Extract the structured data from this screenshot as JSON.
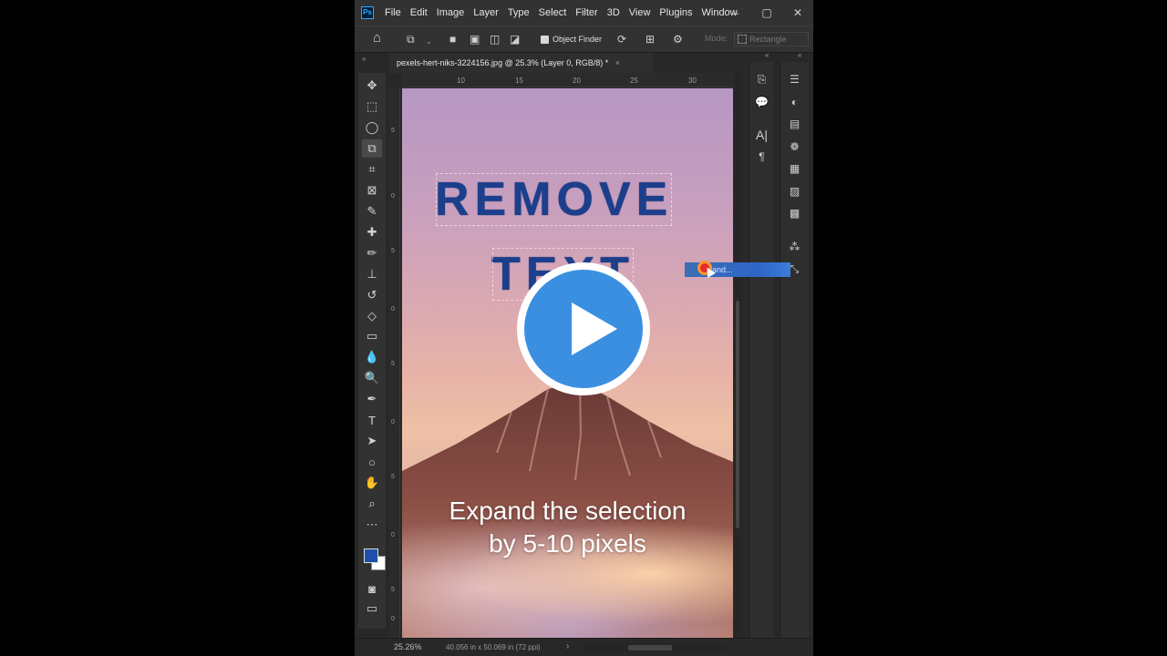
{
  "app": {
    "logo_text": "Ps"
  },
  "menu": {
    "items": [
      "File",
      "Edit",
      "Image",
      "Layer",
      "Type",
      "Select",
      "Filter",
      "3D",
      "View",
      "Plugins",
      "Window"
    ]
  },
  "window_controls": {
    "minimize": "–",
    "maximize": "▢",
    "close": "✕"
  },
  "options_bar": {
    "object_finder_label": "Object Finder",
    "object_finder_checked": true,
    "mode_label": "Mode:",
    "mode_value": "Rectangle"
  },
  "document_tab": {
    "title": "pexels-hert-niks-3224156.jpg @ 25.3% (Layer 0, RGB/8) *",
    "close_glyph": "×"
  },
  "ruler": {
    "top_ticks": [
      "10",
      "15",
      "20",
      "25",
      "30"
    ],
    "left_ticks": [
      "5",
      "0",
      "5",
      "0",
      "5",
      "0",
      "5",
      "0",
      "5",
      "0",
      "5"
    ]
  },
  "toolbar": {
    "tools": [
      {
        "name": "move-tool",
        "glyph": "✥"
      },
      {
        "name": "marquee-tool",
        "glyph": "⬚"
      },
      {
        "name": "lasso-tool",
        "glyph": "◯"
      },
      {
        "name": "object-selection-tool",
        "glyph": "⧉",
        "active": true
      },
      {
        "name": "crop-tool",
        "glyph": "⌗"
      },
      {
        "name": "frame-tool",
        "glyph": "⊠"
      },
      {
        "name": "eyedropper-tool",
        "glyph": "✎"
      },
      {
        "name": "healing-brush-tool",
        "glyph": "✚"
      },
      {
        "name": "brush-tool",
        "glyph": "✏"
      },
      {
        "name": "clone-stamp-tool",
        "glyph": "⊥"
      },
      {
        "name": "history-brush-tool",
        "glyph": "↺"
      },
      {
        "name": "eraser-tool",
        "glyph": "◇"
      },
      {
        "name": "gradient-tool",
        "glyph": "▭"
      },
      {
        "name": "blur-tool",
        "glyph": "💧"
      },
      {
        "name": "dodge-tool",
        "glyph": "🔍"
      },
      {
        "name": "pen-tool",
        "glyph": "✒"
      },
      {
        "name": "type-tool",
        "glyph": "T"
      },
      {
        "name": "path-selection-tool",
        "glyph": "➤"
      },
      {
        "name": "ellipse-tool",
        "glyph": "○"
      },
      {
        "name": "hand-tool",
        "glyph": "✋"
      },
      {
        "name": "zoom-tool",
        "glyph": "⌕"
      },
      {
        "name": "more-tools",
        "glyph": "⋯"
      }
    ],
    "foreground_color": "#1f4fa8",
    "background_color": "#ffffff"
  },
  "canvas": {
    "headline_line1": "REMOVE",
    "headline_line2": "TEXT",
    "caption_line1": "Expand the selection",
    "caption_line2": "by 5-10 pixels",
    "headline_color": "#1c3f8c"
  },
  "overlay": {
    "tooltip_text": "and...",
    "play_button_color": "#3b8fe0"
  },
  "panels": {
    "dock1_icons": [
      "history-icon",
      "comment-icon",
      "character-icon",
      "paragraph-icon"
    ],
    "dock2_icons": [
      "properties-icon",
      "adjustments-icon",
      "libraries-icon",
      "color-icon",
      "swatches-icon",
      "gradients-icon",
      "patterns-icon",
      "channels-icon",
      "paths-icon"
    ]
  },
  "status_bar": {
    "zoom": "25.26%",
    "doc_info": "40.056 in x 50.069 in (72 ppi)",
    "arrow": "›"
  }
}
